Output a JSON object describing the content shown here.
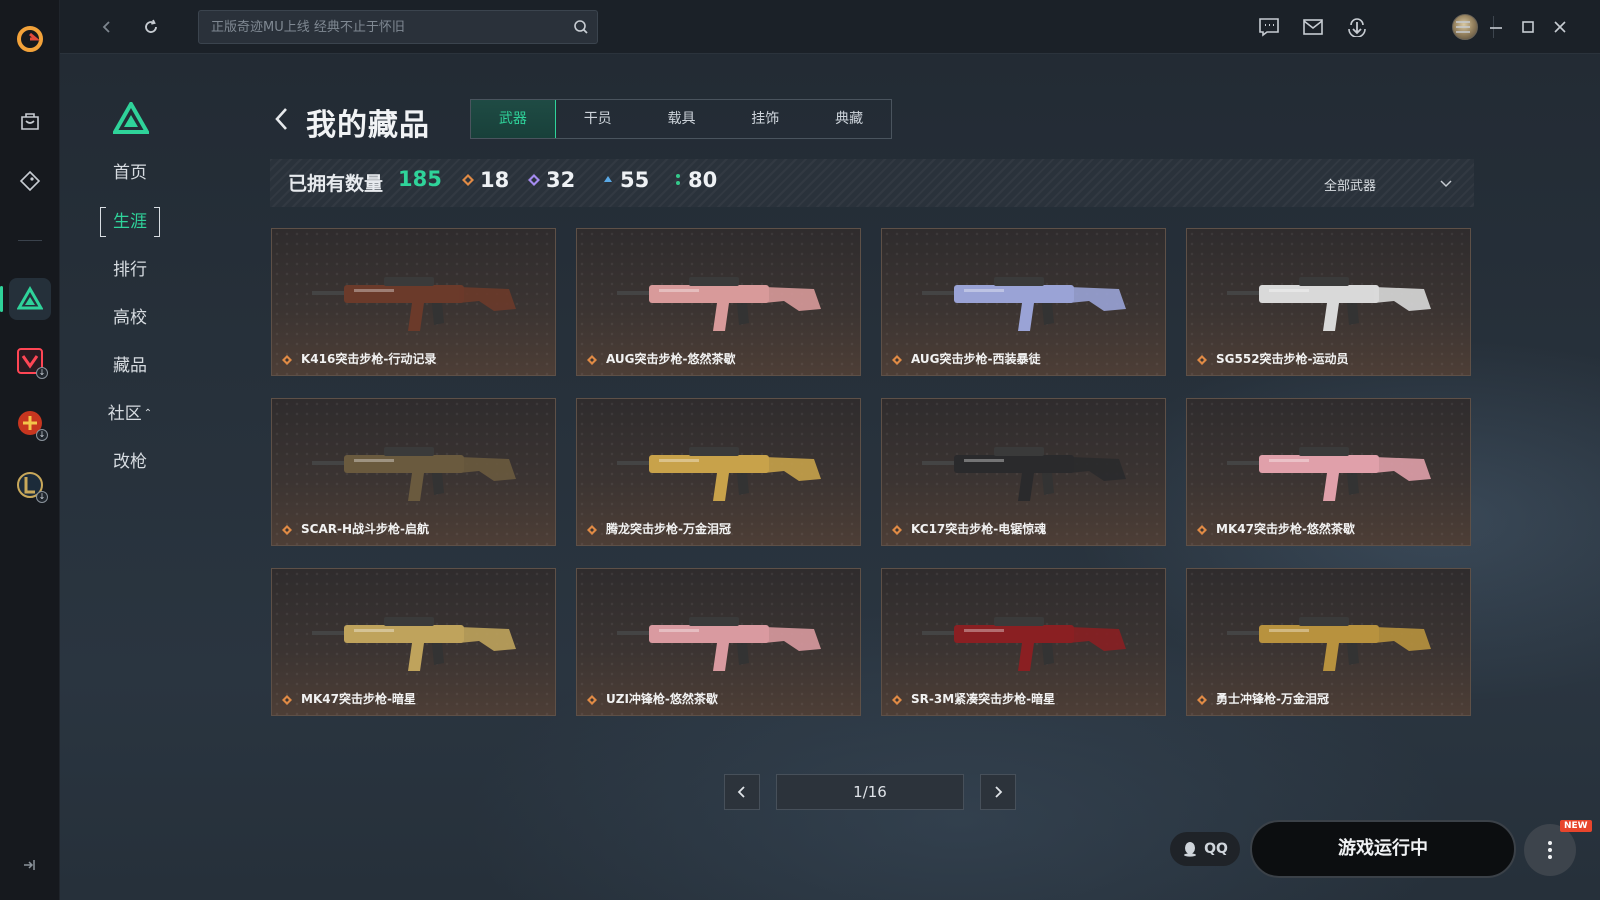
{
  "app": {
    "search_placeholder": "正版奇迹MU上线 经典不止于怀旧",
    "accent": "#2fd39a"
  },
  "rail": {
    "items": [
      {
        "name": "store-icon"
      },
      {
        "name": "tag-icon"
      },
      {
        "name": "game-triangle-icon",
        "active": true
      },
      {
        "name": "valorant-icon"
      },
      {
        "name": "crossfire-icon"
      },
      {
        "name": "lol-icon"
      }
    ]
  },
  "subnav": {
    "items": [
      "首页",
      "生涯",
      "排行",
      "高校",
      "藏品",
      "社区",
      "改枪"
    ],
    "active": "生涯"
  },
  "page": {
    "title": "我的藏品",
    "tabs": [
      "武器",
      "干员",
      "载具",
      "挂饰",
      "典藏"
    ],
    "active_tab": "武器"
  },
  "stats": {
    "owned_label": "已拥有数量",
    "owned_count": "185",
    "rarities": [
      {
        "icon": "orange-diamond-icon",
        "color": "#e08a45",
        "count": "18"
      },
      {
        "icon": "purple-diamond-icon",
        "color": "#a58bf0",
        "count": "32"
      },
      {
        "icon": "blue-diamond-icon",
        "color": "#5aa9e6",
        "count": "55"
      },
      {
        "icon": "green-dot-icon",
        "color": "#34c98b",
        "count": "80"
      }
    ],
    "filter_label": "全部武器"
  },
  "weapons": [
    {
      "name": "K416突击步枪-行动记录",
      "skin": "#6b3a2a"
    },
    {
      "name": "AUG突击步枪-悠然茶歇",
      "skin": "#d89a9a"
    },
    {
      "name": "AUG突击步枪-西装暴徒",
      "skin": "#9aa3d6"
    },
    {
      "name": "SG552突击步枪-运动员",
      "skin": "#d9d9d9"
    },
    {
      "name": "SCAR-H战斗步枪-启航",
      "skin": "#6a5a3e"
    },
    {
      "name": "腾龙突击步枪-万金泪冠",
      "skin": "#c8a24a"
    },
    {
      "name": "KC17突击步枪-电锯惊魂",
      "skin": "#2a2a2c"
    },
    {
      "name": "MK47突击步枪-悠然茶歇",
      "skin": "#e0a0aa"
    },
    {
      "name": "MK47突击步枪-暗星",
      "skin": "#bfa35c"
    },
    {
      "name": "UZI冲锋枪-悠然茶歇",
      "skin": "#d99aa0"
    },
    {
      "name": "SR-3M紧凑突击步枪-暗星",
      "skin": "#8a1f22"
    },
    {
      "name": "勇士冲锋枪-万金泪冠",
      "skin": "#b8923e"
    }
  ],
  "pagination": {
    "current": "1/16"
  },
  "footer": {
    "qq_label": "QQ",
    "run_label": "游戏运行中",
    "new_badge": "NEW"
  }
}
